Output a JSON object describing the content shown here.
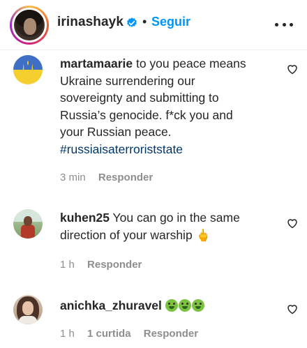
{
  "header": {
    "username": "irinashayk",
    "separator": "•",
    "follow_label": "Seguir"
  },
  "comments": [
    {
      "author": "martamaarie",
      "text_line1": " to you peace means",
      "text_line2": "Ukraine surrendering our",
      "text_line3": "sovereignty and submitting to",
      "text_line4": "Russia’s genocide. f*ck you and",
      "text_line5": "your Russian peace.",
      "hashtag": "#russiaisaterroriststate",
      "time": "3 min",
      "reply_label": "Responder"
    },
    {
      "author": "kuhen25",
      "text_line1": " You can go in the same",
      "text_line2": "direction of your warship ",
      "emoji": "🖕",
      "time": "1 h",
      "reply_label": "Responder"
    },
    {
      "author": "anichka_zhuravel",
      "emoji": "🤮🤮🤮",
      "time": "1 h",
      "likes_label": "1 curtida",
      "reply_label": "Responder"
    }
  ],
  "icons": {
    "verified": "verified-badge-icon",
    "more": "more-options-icon",
    "heart": "heart-outline-icon",
    "ukraine_avatar": "ukraine-trident-icon"
  },
  "colors": {
    "link_blue": "#0095f6",
    "hashtag": "#00376b",
    "muted": "#8e8e8e"
  }
}
